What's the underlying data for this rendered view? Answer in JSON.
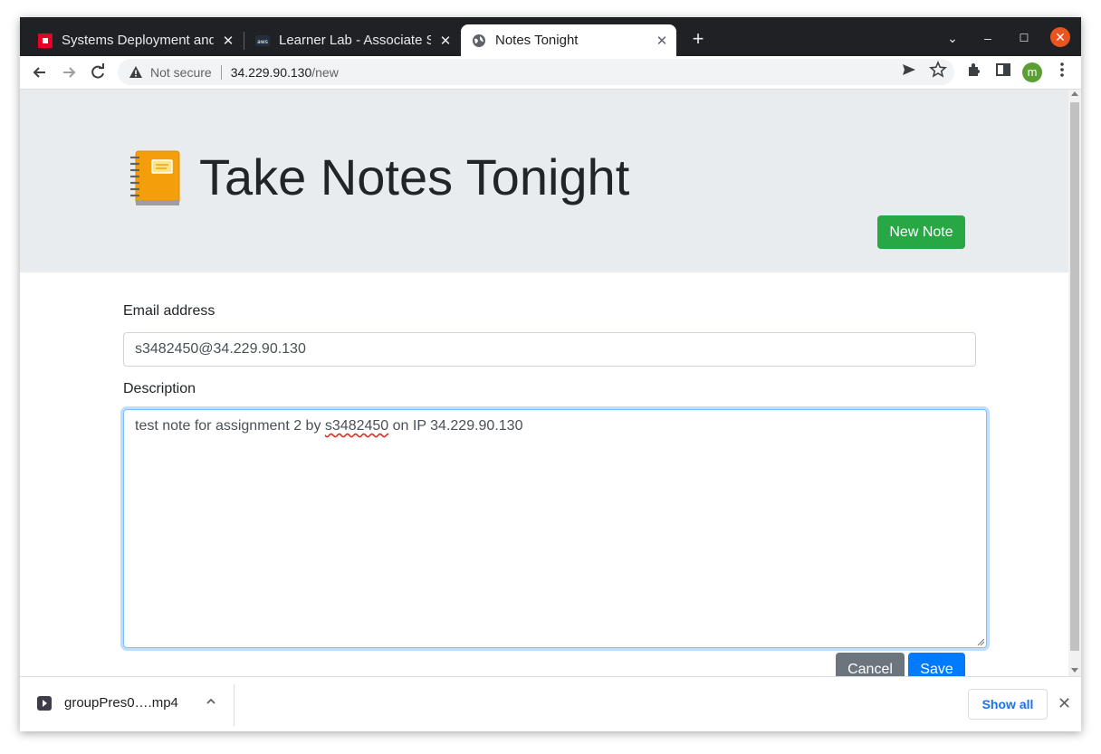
{
  "browser": {
    "tabs": [
      {
        "title": "Systems Deployment and",
        "icon": "rmit-icon",
        "active": false
      },
      {
        "title": "Learner Lab - Associate Se",
        "icon": "aws-icon",
        "active": false
      },
      {
        "title": "Notes Tonight",
        "icon": "globe-icon",
        "active": true
      }
    ],
    "new_tab": "+",
    "controls": {
      "dropdown": "⌄",
      "minimize": "–",
      "maximize": "☐",
      "close": "✕"
    },
    "address": {
      "security": "Not secure",
      "host": "34.229.90.130",
      "path": "/new"
    },
    "profile_initial": "m"
  },
  "page": {
    "title": "Take Notes Tonight",
    "new_note_button": "New Note",
    "form": {
      "email_label": "Email address",
      "email_value": "s3482450@34.229.90.130",
      "description_label": "Description",
      "description_parts": {
        "before": "test note for assignment 2 by ",
        "misspelled": "s3482450",
        "after": " on IP 34.229.90.130"
      },
      "cancel_button": "Cancel",
      "save_button": "Save"
    }
  },
  "downloads": {
    "file_name": "groupPres0….mp4",
    "show_all": "Show all"
  },
  "colors": {
    "jumbotron": "#e9ecef",
    "success": "#28a745",
    "primary": "#007bff",
    "secondary": "#6c757d"
  }
}
